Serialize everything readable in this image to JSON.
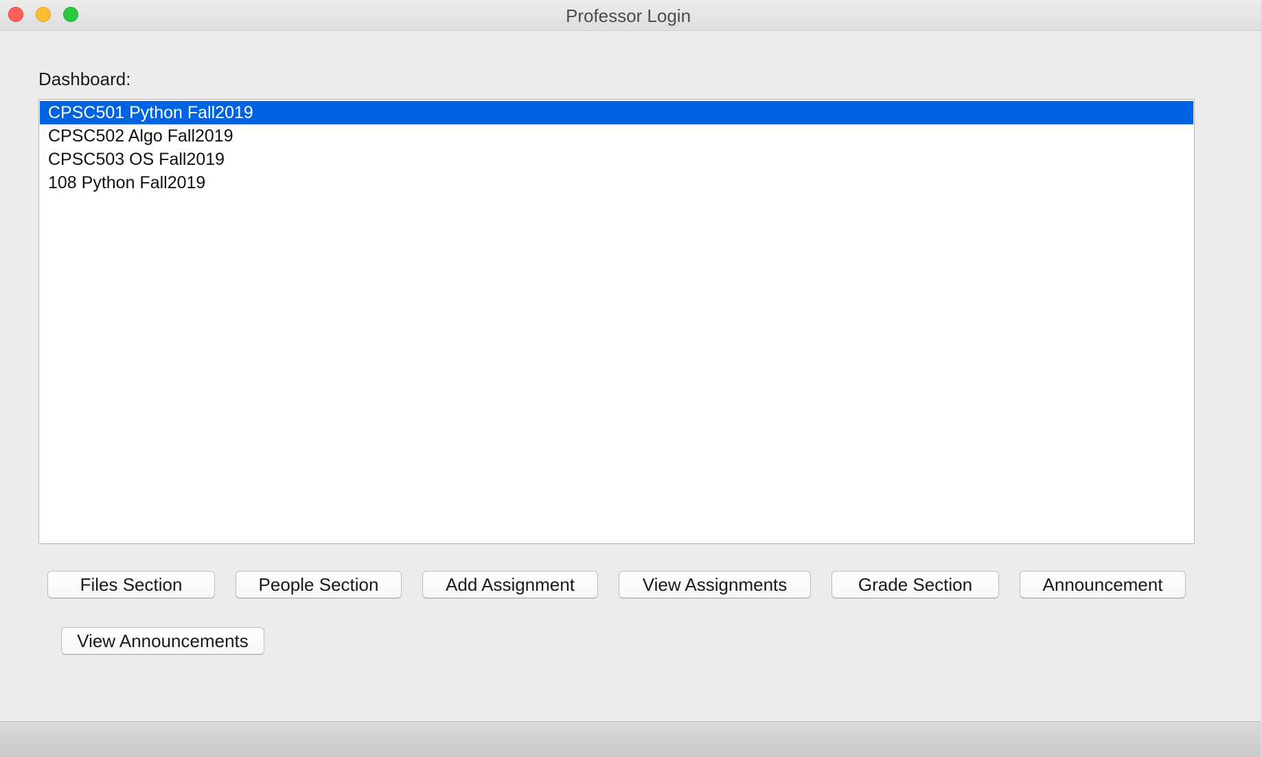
{
  "window": {
    "title": "Professor Login"
  },
  "dashboard": {
    "label": "Dashboard:",
    "courses": [
      {
        "label": "CPSC501 Python Fall2019",
        "selected": true
      },
      {
        "label": "CPSC502 Algo Fall2019",
        "selected": false
      },
      {
        "label": "CPSC503 OS Fall2019",
        "selected": false
      },
      {
        "label": "108 Python Fall2019",
        "selected": false
      }
    ]
  },
  "buttons": {
    "files_section": "Files Section",
    "people_section": "People Section",
    "add_assignment": "Add Assignment",
    "view_assignments": "View Assignments",
    "grade_section": "Grade Section",
    "announcement": "Announcement",
    "view_announcements": "View Announcements"
  },
  "colors": {
    "selection": "#0063e1",
    "window_bg": "#ececec",
    "close": "#fe5f57",
    "minimize": "#febc2e",
    "maximize": "#28c840"
  }
}
